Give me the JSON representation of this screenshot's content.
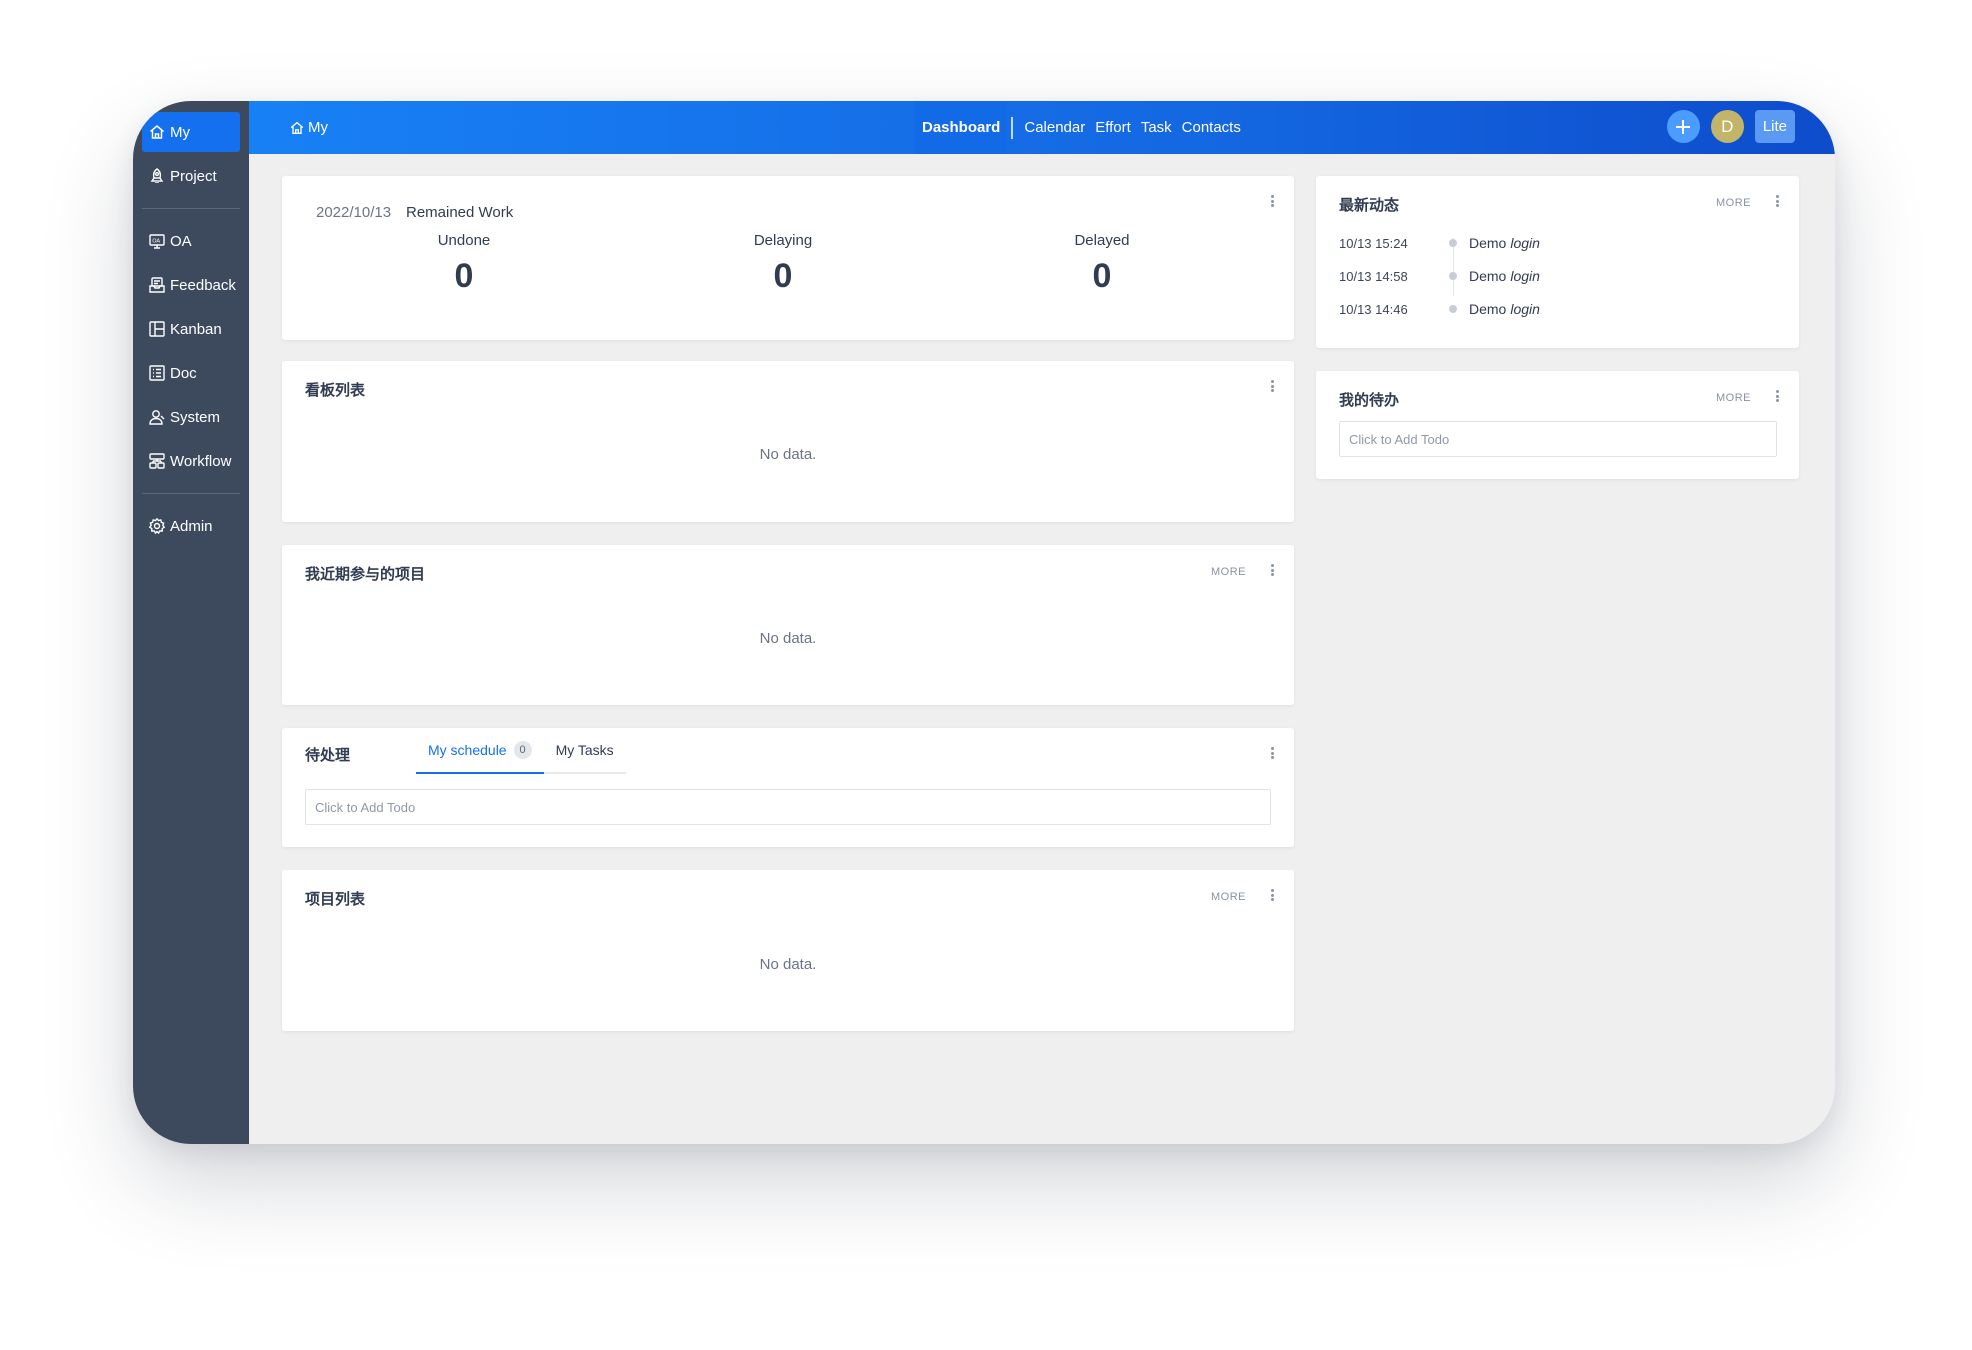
{
  "sidebar": {
    "items": [
      {
        "label": "My",
        "icon": "home-icon",
        "active": true
      },
      {
        "label": "Project",
        "icon": "rocket-icon"
      },
      {
        "label": "OA",
        "icon": "oa-monitor-icon"
      },
      {
        "label": "Feedback",
        "icon": "feedback-tray-icon"
      },
      {
        "label": "Kanban",
        "icon": "kanban-board-icon"
      },
      {
        "label": "Doc",
        "icon": "doc-list-icon"
      },
      {
        "label": "System",
        "icon": "user-system-icon"
      },
      {
        "label": "Workflow",
        "icon": "workflow-icon"
      },
      {
        "label": "Admin",
        "icon": "gear-icon"
      }
    ]
  },
  "topbar": {
    "breadcrumb": "My",
    "nav": [
      "Dashboard",
      "Calendar",
      "Effort",
      "Task",
      "Contacts"
    ],
    "active_nav": "Dashboard",
    "avatar_initial": "D",
    "lite_label": "Lite"
  },
  "colors": {
    "accent": "#1570ef",
    "sidebar_bg": "#3d4a5e",
    "topbar_start": "#1880f5",
    "topbar_end": "#0e4ccc",
    "avatar_bg": "#c2b567"
  },
  "remained_work": {
    "date": "2022/10/13",
    "title": "Remained Work",
    "stats": [
      {
        "label": "Undone",
        "value": "0"
      },
      {
        "label": "Delaying",
        "value": "0"
      },
      {
        "label": "Delayed",
        "value": "0"
      }
    ]
  },
  "kanban_panel": {
    "title": "看板列表",
    "empty": "No data."
  },
  "recent_projects": {
    "title": "我近期参与的项目",
    "more": "MORE",
    "empty": "No data."
  },
  "pending": {
    "title": "待处理",
    "tabs": [
      {
        "label": "My schedule",
        "count": "0",
        "active": true
      },
      {
        "label": "My Tasks"
      }
    ],
    "todo_placeholder": "Click to Add Todo"
  },
  "project_list": {
    "title": "项目列表",
    "more": "MORE",
    "empty": "No data."
  },
  "latest_activity": {
    "title": "最新动态",
    "more": "MORE",
    "items": [
      {
        "time": "10/13 15:24",
        "user": "Demo",
        "action": "login"
      },
      {
        "time": "10/13 14:58",
        "user": "Demo",
        "action": "login"
      },
      {
        "time": "10/13 14:46",
        "user": "Demo",
        "action": "login"
      }
    ]
  },
  "my_todo": {
    "title": "我的待办",
    "more": "MORE",
    "todo_placeholder": "Click to Add Todo"
  }
}
